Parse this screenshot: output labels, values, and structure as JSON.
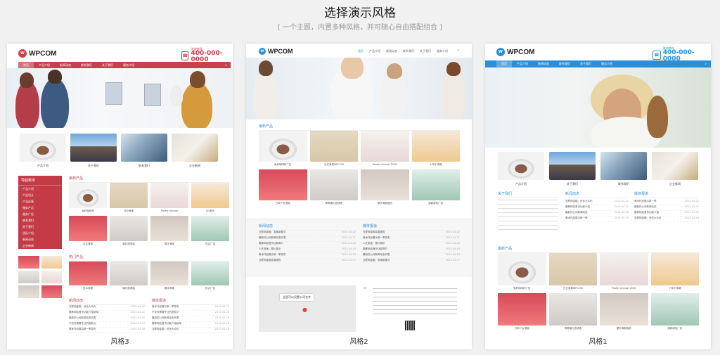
{
  "header": {
    "title": "选择演示风格",
    "subtitle": "[ 一个主题，内置多种风格，并可随心自由搭配组合 ]"
  },
  "styles": [
    {
      "label": "风格3",
      "accent": "#c8404c",
      "logo": "WPCOM",
      "phone_label": "咨询热线",
      "phone": "400-000-0000",
      "nav": [
        "首页",
        "产品介绍",
        "新闻动态",
        "联系我们",
        "关于我们",
        "服务介绍"
      ],
      "thumbs": [
        "产品介绍",
        "关于我们",
        "联系我们",
        "企业新闻"
      ],
      "side_menu_title": "导航菜单",
      "side_menu_items": [
        "产品介绍",
        "产品设计",
        "产品运营",
        "服务产品",
        "服务广告",
        "联系我们",
        "关于我们",
        "团队介绍",
        "新闻动态",
        "企业新闻"
      ],
      "section1": "最新产品",
      "section2": "热门产品",
      "section3": "新闻动态",
      "section4": "媒体报道",
      "products": [
        "免杯咖啡杯",
        "元旦海报",
        "Poster Annual",
        "QQ音乐",
        "日本海报",
        "婚礼邀请函",
        "题字海报",
        "热点广告"
      ],
      "news": [
        "互联网金融：优化大众化",
        "搬移网站首页功能介绍使用",
        "最新的公司新闻动态列表",
        "不仅仅需要专业的团队化",
        "美术作品展示新一季发布"
      ],
      "news_dates": [
        "2015-04-22",
        "2015-04-21",
        "2015-04-20",
        "2015-04-19",
        "2015-04-18"
      ]
    },
    {
      "label": "风格2",
      "accent": "#2f8ed8",
      "logo": "WPCOM",
      "nav": [
        "首页",
        "产品介绍",
        "新闻动态",
        "联系我们",
        "关于我们",
        "服务介绍"
      ],
      "section1": "最新产品",
      "section2": "新闻动态",
      "section3": "媒体报道",
      "products": [
        "免杯咖啡杯广告",
        "元旦海报WPCOM",
        "Poster Annual 2016",
        "十年乐传路",
        "日本少女漫画",
        "精美婚礼邀请函",
        "题字海报画册",
        "清新绿色广告"
      ],
      "news": [
        "互联网金融：发展新模式",
        "最新的公司新闻动态列表",
        "搬移网站首页功能简介",
        "人在旅途：图片展示",
        "美术作品展示新一季发布",
        "互联网金融发展报告"
      ],
      "news_dates": [
        "2015-04-22",
        "2015-04-21",
        "2015-04-20",
        "2015-04-19",
        "2015-04-18",
        "2015-04-17"
      ],
      "map_label": "这里可以设置公司名字"
    },
    {
      "label": "风格1",
      "accent": "#2a8fd6",
      "logo": "WPCOM",
      "phone_label": "咨询热线",
      "phone": "400-000-0000",
      "nav": [
        "首页",
        "产品介绍",
        "新闻动态",
        "联系我们",
        "关于我们",
        "服务介绍"
      ],
      "thumbs": [
        "产品介绍",
        "关于我们",
        "联系我们",
        "企业新闻"
      ],
      "section1": "关于我们",
      "section2": "新闻动态",
      "section3": "媒体报道",
      "section4": "最新产品",
      "products": [
        "免杯咖啡杯广告",
        "元旦海报WPCOM",
        "Poster Annual 2016",
        "十年乐传路",
        "日本少女漫画",
        "精美婚礼邀请函",
        "题字海报画册",
        "清新绿色广告"
      ],
      "news": [
        "互联网金融：优化大众化",
        "搬移网站首页功能介绍",
        "最新的公司新闻动态",
        "美术作品展示新一季"
      ],
      "news_dates": [
        "2015-04-22",
        "2015-04-21",
        "2015-04-20",
        "2015-04-19"
      ]
    }
  ]
}
